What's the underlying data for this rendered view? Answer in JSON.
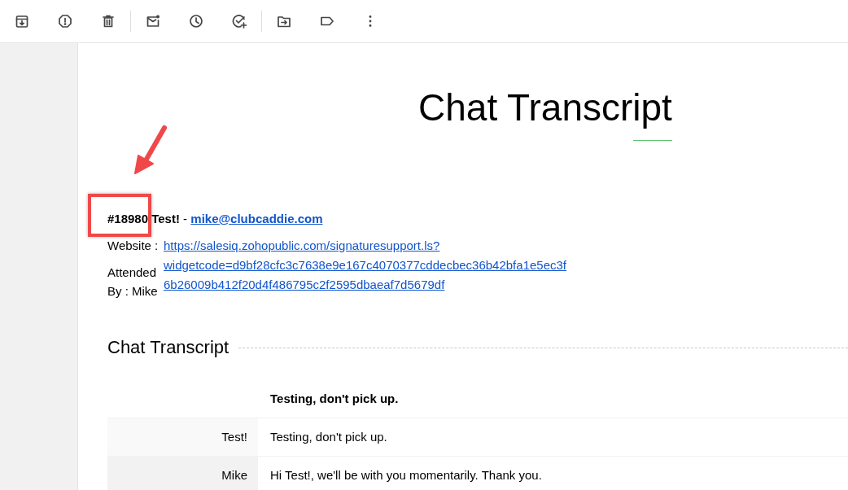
{
  "title": "Chat Transcript",
  "header": {
    "text": "**#18980 Test!** - ",
    "email": "mike@clubcaddie.com"
  },
  "details": {
    "website_label": "Website :",
    "website_url": "https://salesiq.zohopublic.com/signaturesupport.ls?widgetcode=d9bf28cfc3c7638e9e167c4070377cddecbec36b42bfa1e5ec3f6b26009b412f20d4f486795c2f2595dbaeaf7d5679df",
    "attended_by": "Attended By : Mike"
  },
  "transcript": {
    "section_title": "Chat Transcript",
    "subject": "Testing, don't pick up.",
    "messages": [
      {
        "sender": "Test!",
        "text": "Testing, don't pick up."
      },
      {
        "sender": "Mike",
        "text": "Hi Test!, we'll be with you momentarily. Thank you."
      }
    ]
  }
}
